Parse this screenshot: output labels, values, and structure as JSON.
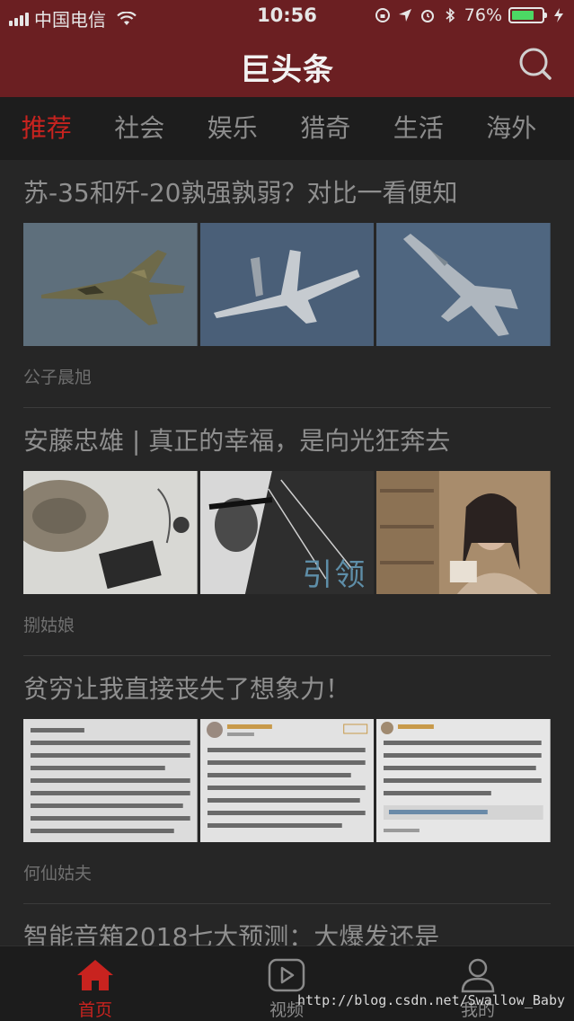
{
  "status_bar": {
    "carrier": "中国电信",
    "time": "10:56",
    "battery": "76%",
    "battery_level": 0.76
  },
  "header": {
    "title": "巨头条",
    "search_icon": "search-icon"
  },
  "tabs": [
    {
      "label": "推荐",
      "active": true
    },
    {
      "label": "社会"
    },
    {
      "label": "娱乐"
    },
    {
      "label": "猎奇"
    },
    {
      "label": "生活"
    },
    {
      "label": "海外"
    }
  ],
  "feed": [
    {
      "title": "苏-35和歼-20孰强孰弱？对比一看便知",
      "source": "公子晨旭"
    },
    {
      "title": "安藤忠雄 | 真正的幸福，是向光狂奔去",
      "source": "捌姑娘",
      "image_text": "引领"
    },
    {
      "title": "贫穷让我直接丧失了想象力！",
      "source": "何仙姑夫"
    },
    {
      "title": "智能音箱2018七大预测：大爆发还是",
      "source": ""
    }
  ],
  "bottom_nav": [
    {
      "label": "首页",
      "icon": "home-icon",
      "active": true
    },
    {
      "label": "视频",
      "icon": "video-icon"
    },
    {
      "label": "我的",
      "icon": "user-icon"
    }
  ],
  "watermark": "http://blog.csdn.net/Swallow_Baby",
  "colors": {
    "header_bg": "#6b1f22",
    "accent": "#c8231f",
    "background": "#262626"
  }
}
